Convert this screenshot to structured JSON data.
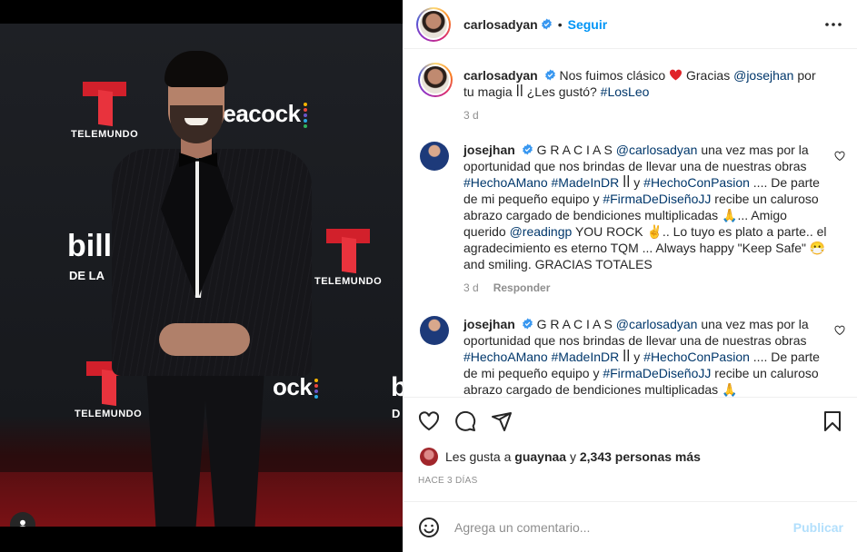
{
  "photo": {
    "logos": {
      "telemundo": "TELEMUNDO",
      "peacock": "peacock",
      "peacock_partial": "ock",
      "billboard_partial": "bill",
      "billboard_sub": "DE LA",
      "billboard_edge": "b",
      "billboard_edge_sub": "D"
    },
    "tag_icon": "user-icon"
  },
  "header": {
    "username": "carlosadyan",
    "separator": "•",
    "follow_label": "Seguir",
    "more_icon": "more-horizontal-icon"
  },
  "caption": {
    "username": "carlosadyan",
    "text_1": "Nos fuimos clásico",
    "text_2": "Gracias",
    "mention": "@josejhan",
    "text_3": "por tu magia ꟾꟾ ¿Les gustó?",
    "hashtag": "#LosLeo",
    "time": "3 d"
  },
  "comments": [
    {
      "username": "josejhan",
      "lead": "G R A C I A S",
      "mention_1": "@carlosadyan",
      "t1": "una vez mas por la oportunidad que nos brindas de llevar una de nuestras obras",
      "h1": "#HechoAMano",
      "h2": "#MadeInDR",
      "t2": "ꟾꟾ y",
      "h3": "#HechoConPasion",
      "t3": ".... De parte de mi pequeño equipo y",
      "h4": "#FirmaDeDiseñoJJ",
      "t4": "recibe un caluroso abrazo cargado de bendiciones multiplicadas 🙏... Amigo querido",
      "mention_2": "@readingp",
      "t5": "YOU ROCK ✌️.. Lo tuyo es plato a parte.. el agradecimiento es eterno TQM ... Always happy \"Keep Safe\" 😷 and smiling. GRACIAS TOTALES",
      "time": "3 d",
      "reply_label": "Responder"
    },
    {
      "username": "josejhan",
      "lead": "G R A C I A S",
      "mention_1": "@carlosadyan",
      "t1": "una vez mas por la oportunidad que nos brindas de llevar una de nuestras obras",
      "h1": "#HechoAMano",
      "h2": "#MadeInDR",
      "t2": "ꟾꟾ y",
      "h3": "#HechoConPasion",
      "t3": ".... De parte de mi pequeño equipo y",
      "h4": "#FirmaDeDiseñoJJ",
      "t4": "recibe un caluroso abrazo cargado de bendiciones multiplicadas 🙏"
    }
  ],
  "actions": {
    "like_icon": "heart-icon",
    "comment_icon": "comment-icon",
    "share_icon": "send-icon",
    "save_icon": "bookmark-icon"
  },
  "likes": {
    "prefix": "Les gusta a",
    "user": "guaynaa",
    "connector": "y",
    "count": "2,343 personas más"
  },
  "posted_ago": "HACE 3 DÍAS",
  "composer": {
    "placeholder": "Agrega un comentario...",
    "publish_label": "Publicar",
    "emoji_icon": "emoji-icon"
  },
  "colors": {
    "accent": "#0095f6",
    "link": "#00376b",
    "muted": "#8e8e8e",
    "text": "#262626",
    "telemundo_red": "#d2202b",
    "publish_disabled": "#b2dffc"
  }
}
